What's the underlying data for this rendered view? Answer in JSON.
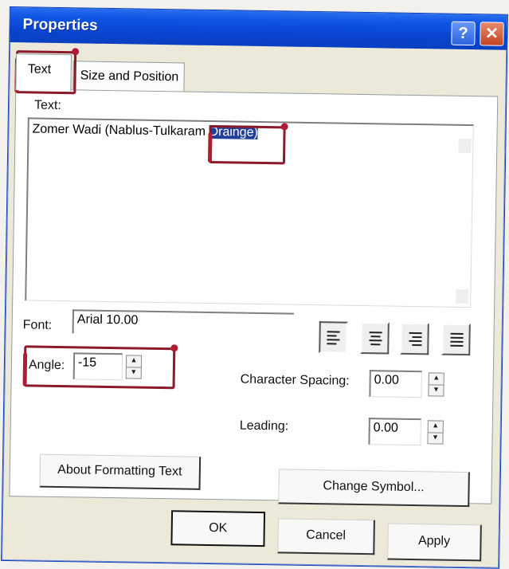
{
  "window": {
    "title": "Properties",
    "help_glyph": "?",
    "close_glyph": "✕"
  },
  "tabs": [
    {
      "label": "Text",
      "active": true
    },
    {
      "label": "Size and Position",
      "active": false
    }
  ],
  "text_section": {
    "label": "Text:",
    "value_before": "Zomer Wadi (Nablus-Tulkaram ",
    "value_selected": "Drainge)"
  },
  "font": {
    "label": "Font:",
    "value": "Arial 10.00"
  },
  "alignment": {
    "options": [
      "left",
      "center",
      "right",
      "justify"
    ],
    "selected": "left"
  },
  "angle": {
    "label": "Angle:",
    "value": "-15"
  },
  "character_spacing": {
    "label": "Character Spacing:",
    "value": "0.00"
  },
  "leading": {
    "label": "Leading:",
    "value": "0.00"
  },
  "buttons": {
    "about": "About Formatting Text",
    "change_symbol": "Change Symbol...",
    "ok": "OK",
    "cancel": "Cancel",
    "apply": "Apply"
  },
  "colors": {
    "titlebar": "#0a46d4",
    "annotation": "#8b1a2b",
    "selection": "#1f3f9b"
  }
}
